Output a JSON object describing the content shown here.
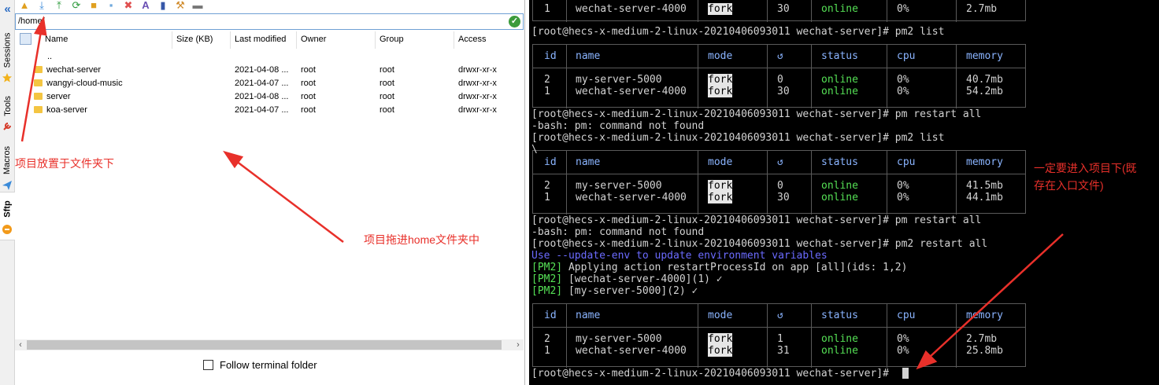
{
  "side_tabs": {
    "collapse": "«",
    "sessions": "Sessions",
    "tools": "Tools",
    "macros": "Macros",
    "sftp": "Sftp"
  },
  "sftp": {
    "path": "/home/",
    "header": {
      "name": "Name",
      "size": "Size (KB)",
      "modified": "Last modified",
      "owner": "Owner",
      "group": "Group",
      "access": "Access"
    },
    "parent": "..",
    "files": [
      {
        "name": "wechat-server",
        "modified": "2021-04-08 ...",
        "owner": "root",
        "group": "root",
        "access": "drwxr-xr-x"
      },
      {
        "name": "wangyi-cloud-music",
        "modified": "2021-04-07 ...",
        "owner": "root",
        "group": "root",
        "access": "drwxr-xr-x"
      },
      {
        "name": "server",
        "modified": "2021-04-08 ...",
        "owner": "root",
        "group": "root",
        "access": "drwxr-xr-x"
      },
      {
        "name": "koa-server",
        "modified": "2021-04-07 ...",
        "owner": "root",
        "group": "root",
        "access": "drwxr-xr-x"
      }
    ],
    "follow_label": "Follow terminal folder"
  },
  "annotations": {
    "left": "项目放置于文件夹下",
    "middle": "项目拖进home文件夹中",
    "right_line1": "一定要进入项目下(既",
    "right_line2": "存在入口文件)",
    "color": "#e8302a"
  },
  "terminal": {
    "prompt": "[root@hecs-x-medium-2-linux-20210406093011 wechat-server]#",
    "cmd_pm2_list": "pm2 list",
    "cmd_pm_restart": "pm restart all",
    "cmd_pm2_restart": "pm2 restart all",
    "err_pm": "-bash: pm: command not found",
    "stray": "\\",
    "update_env": "Use --update-env to update environment variables",
    "pm2_tag": "[PM2]",
    "apply_msg": "Applying action restartProcessId on app [all](ids: 1,2)",
    "restarted_1": "[wechat-server-4000](1) ✓",
    "restarted_2": "[my-server-5000](2) ✓",
    "table_headers": {
      "id": "id",
      "name": "name",
      "mode": "mode",
      "restarts": "↺",
      "status": "status",
      "cpu": "cpu",
      "memory": "memory"
    },
    "top_row": {
      "id": "1",
      "name": "wechat-server-4000",
      "mode": "fork",
      "restarts": "30",
      "status": "online",
      "cpu": "0%",
      "memory": "2.7mb"
    },
    "tables": [
      {
        "rows": [
          {
            "id": "2",
            "name": "my-server-5000",
            "mode": "fork",
            "restarts": "0",
            "status": "online",
            "cpu": "0%",
            "memory": "40.7mb"
          },
          {
            "id": "1",
            "name": "wechat-server-4000",
            "mode": "fork",
            "restarts": "30",
            "status": "online",
            "cpu": "0%",
            "memory": "54.2mb"
          }
        ]
      },
      {
        "rows": [
          {
            "id": "2",
            "name": "my-server-5000",
            "mode": "fork",
            "restarts": "0",
            "status": "online",
            "cpu": "0%",
            "memory": "41.5mb"
          },
          {
            "id": "1",
            "name": "wechat-server-4000",
            "mode": "fork",
            "restarts": "30",
            "status": "online",
            "cpu": "0%",
            "memory": "44.1mb"
          }
        ]
      },
      {
        "rows": [
          {
            "id": "2",
            "name": "my-server-5000",
            "mode": "fork",
            "restarts": "1",
            "status": "online",
            "cpu": "0%",
            "memory": "2.7mb"
          },
          {
            "id": "1",
            "name": "wechat-server-4000",
            "mode": "fork",
            "restarts": "31",
            "status": "online",
            "cpu": "0%",
            "memory": "25.8mb"
          }
        ]
      }
    ]
  }
}
